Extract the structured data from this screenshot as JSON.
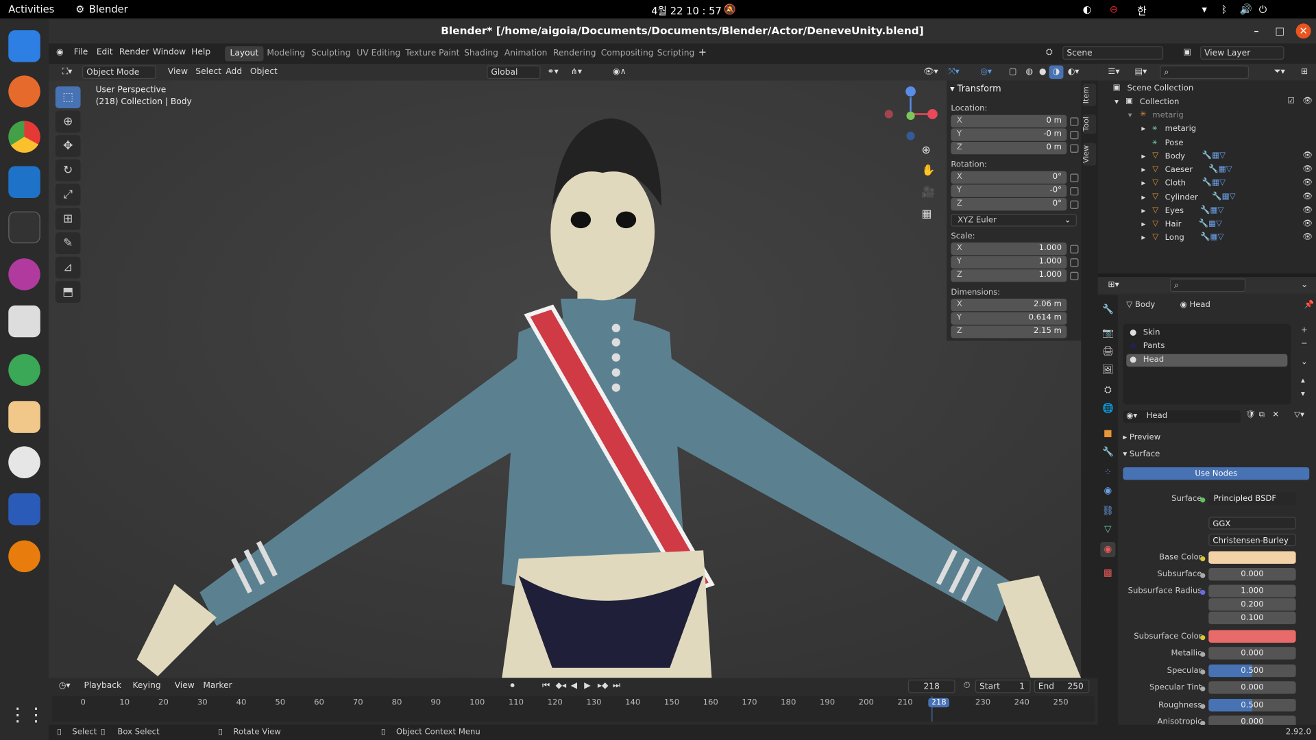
{
  "topbar": {
    "activities": "Activities",
    "app": "Blender",
    "clock": "4월 22  10 : 57",
    "ime": "한"
  },
  "window": {
    "title": "Blender* [/home/aigoia/Documents/Documents/Blender/Actor/DeneveUnity.blend]"
  },
  "menu": {
    "items": [
      "File",
      "Edit",
      "Render",
      "Window",
      "Help"
    ]
  },
  "workspaces": [
    "Layout",
    "Modeling",
    "Sculpting",
    "UV Editing",
    "Texture Paint",
    "Shading",
    "Animation",
    "Rendering",
    "Compositing",
    "Scripting"
  ],
  "scene": {
    "label": "Scene",
    "view_layer": "View Layer"
  },
  "vp_header": {
    "mode": "Object Mode",
    "view": "View",
    "select": "Select",
    "add": "Add",
    "object": "Object",
    "orientation": "Global"
  },
  "viewport": {
    "perspective": "User Perspective",
    "collection": "(218) Collection | Body"
  },
  "npanel": {
    "title": "Transform",
    "location": "Location:",
    "rotation": "Rotation:",
    "scale": "Scale:",
    "dimensions": "Dimensions:",
    "loc": [
      {
        "k": "X",
        "v": "0 m"
      },
      {
        "k": "Y",
        "v": "-0 m"
      },
      {
        "k": "Z",
        "v": "0 m"
      }
    ],
    "rot": [
      {
        "k": "X",
        "v": "0°"
      },
      {
        "k": "Y",
        "v": "-0°"
      },
      {
        "k": "Z",
        "v": "0°"
      }
    ],
    "rot_mode": "XYZ Euler",
    "scl": [
      {
        "k": "X",
        "v": "1.000"
      },
      {
        "k": "Y",
        "v": "1.000"
      },
      {
        "k": "Z",
        "v": "1.000"
      }
    ],
    "dim": [
      {
        "k": "X",
        "v": "2.06 m"
      },
      {
        "k": "Y",
        "v": "0.614 m"
      },
      {
        "k": "Z",
        "v": "2.15 m"
      }
    ]
  },
  "sidetabs": [
    "Item",
    "Tool",
    "View"
  ],
  "outliner": {
    "scene_collection": "Scene Collection",
    "collection": "Collection",
    "metarig_parent": "metarig",
    "rows": [
      "metarig",
      "Pose",
      "Body",
      "Caeser",
      "Cloth",
      "Cylinder",
      "Eyes",
      "Hair",
      "Long"
    ]
  },
  "props": {
    "object": "Body",
    "material": "Head",
    "slots": [
      "Skin",
      "Pants",
      "Head"
    ],
    "mat_name": "Head",
    "preview": "Preview",
    "surface_panel": "Surface",
    "use_nodes": "Use Nodes",
    "surface_label": "Surface",
    "surface_value": "Principled BSDF",
    "distribution": "GGX",
    "subsurface_method": "Christensen-Burley",
    "base_color_label": "Base Color",
    "base_color": "#f3d2a8",
    "subsurface_label": "Subsurface",
    "subsurface": "0.000",
    "ss_radius_label": "Subsurface Radius",
    "ss_radius": [
      "1.000",
      "0.200",
      "0.100"
    ],
    "ss_color_label": "Subsurface Color",
    "ss_color": "#e96a6a",
    "metallic_label": "Metallic",
    "metallic": "0.000",
    "specular_label": "Specular",
    "specular": "0.500",
    "spec_tint_label": "Specular Tint",
    "spec_tint": "0.000",
    "roughness_label": "Roughness",
    "roughness": "0.500",
    "anisotropic_label": "Anisotropic",
    "anisotropic": "0.000"
  },
  "timeline": {
    "playback": "Playback",
    "keying": "Keying",
    "view": "View",
    "marker": "Marker",
    "current": "218",
    "start_label": "Start",
    "start": "1",
    "end_label": "End",
    "end": "250",
    "ticks": [
      "0",
      "10",
      "20",
      "30",
      "40",
      "50",
      "60",
      "70",
      "80",
      "90",
      "100",
      "110",
      "120",
      "130",
      "140",
      "150",
      "160",
      "170",
      "180",
      "190",
      "200",
      "210",
      "218",
      "230",
      "240",
      "250"
    ]
  },
  "status": {
    "select": "Select",
    "box_select": "Box Select",
    "rotate_view": "Rotate View",
    "context_menu": "Object Context Menu",
    "version": "2.92.0"
  }
}
